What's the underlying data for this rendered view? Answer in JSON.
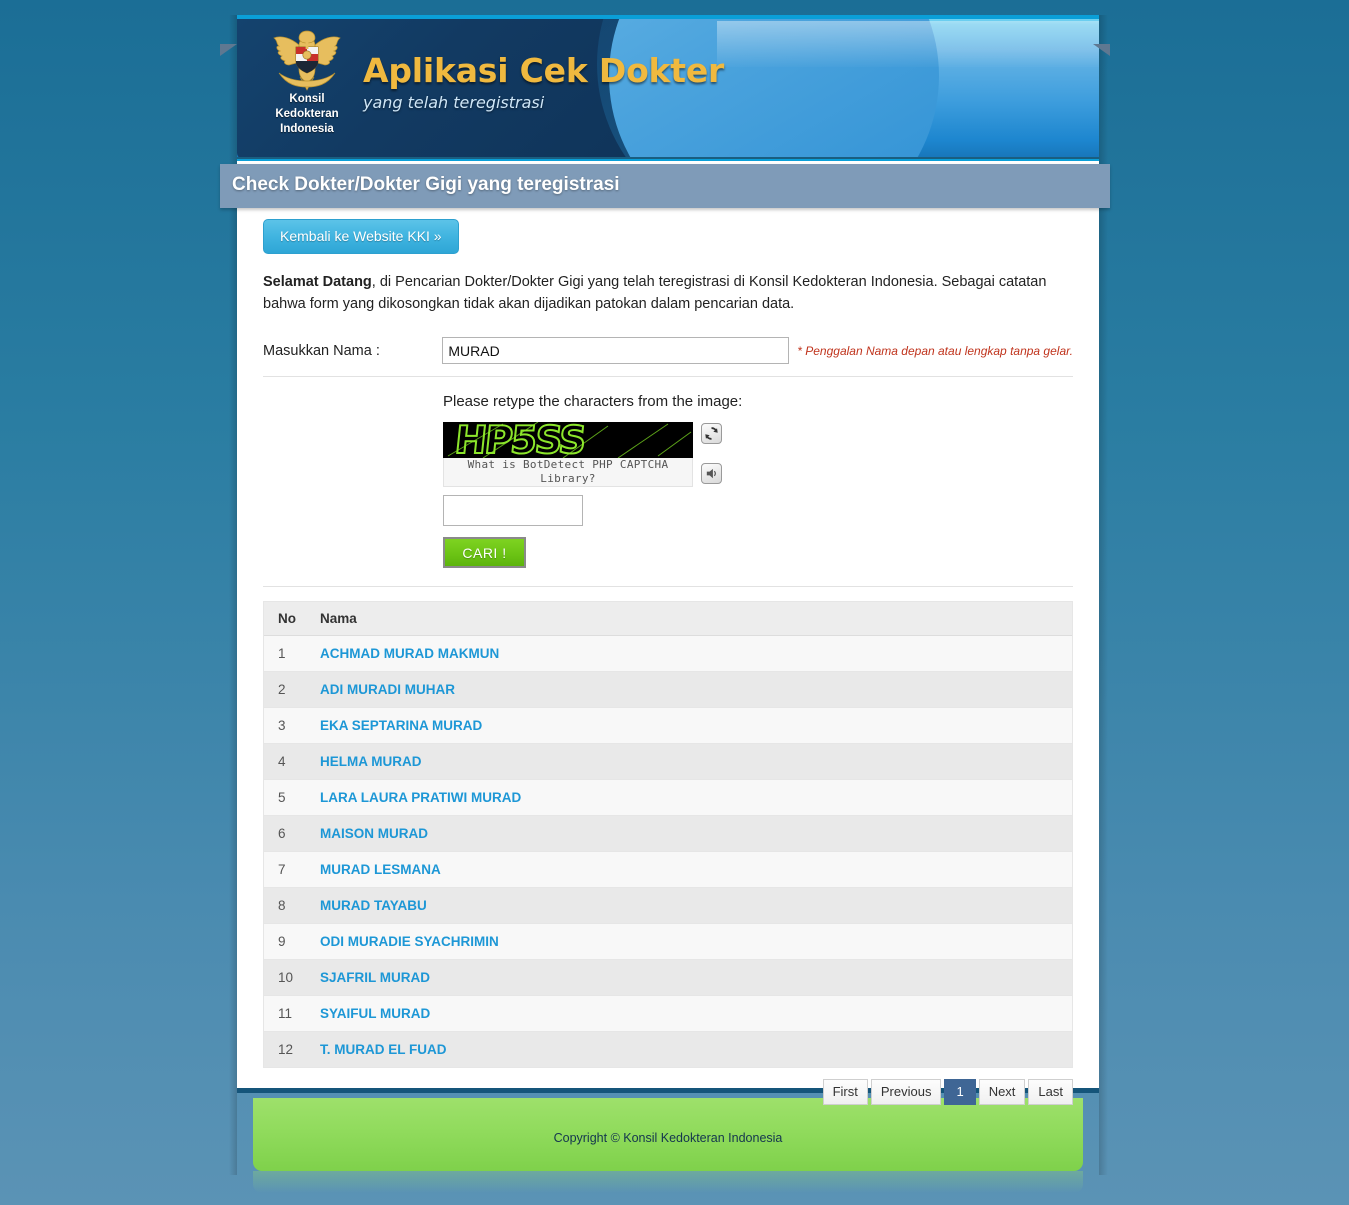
{
  "brand": {
    "emblem_caption_line1": "Konsil",
    "emblem_caption_line2": "Kedokteran",
    "emblem_caption_line3": "Indonesia",
    "title": "Aplikasi Cek Dokter",
    "subtitle": "yang telah teregistrasi",
    "title_color": "#f0b93f"
  },
  "ribbon": {
    "title": "Check Dokter/Dokter Gigi yang teregistrasi",
    "background": "#7f9bb8"
  },
  "actions": {
    "back_label": "Kembali ke Website KKI »"
  },
  "welcome": {
    "lead": "Selamat Datang",
    "rest": ", di Pencarian Dokter/Dokter Gigi yang telah teregistrasi di Konsil Kedokteran Indonesia. Sebagai catatan bahwa form yang dikosongkan tidak akan dijadikan patokan dalam pencarian data."
  },
  "form": {
    "name_label": "Masukkan Nama :",
    "name_value": "MURAD",
    "name_placeholder": "",
    "name_hint": "* Penggalan Nama depan atau lengkap tanpa gelar.",
    "hint_color": "#c0341d",
    "captcha_prompt": "Please retype the characters from the image:",
    "captcha_text": "HP5SS",
    "captcha_link": "What is BotDetect PHP CAPTCHA Library?",
    "captcha_input_value": "",
    "captcha_input_placeholder": "",
    "reload_icon": "refresh-icon",
    "sound_icon": "sound-icon",
    "submit_label": "CARI !",
    "submit_color": "#6cc415"
  },
  "results": {
    "columns": [
      "No",
      "Nama"
    ],
    "rows": [
      {
        "no": "1",
        "name": "ACHMAD MURAD MAKMUN"
      },
      {
        "no": "2",
        "name": "ADI MURADI MUHAR"
      },
      {
        "no": "3",
        "name": "EKA SEPTARINA MURAD"
      },
      {
        "no": "4",
        "name": "HELMA MURAD"
      },
      {
        "no": "5",
        "name": "LARA LAURA PRATIWI MURAD"
      },
      {
        "no": "6",
        "name": "MAISON MURAD"
      },
      {
        "no": "7",
        "name": "MURAD LESMANA"
      },
      {
        "no": "8",
        "name": "MURAD TAYABU"
      },
      {
        "no": "9",
        "name": "ODI MURADIE SYACHRIMIN"
      },
      {
        "no": "10",
        "name": "SJAFRIL MURAD"
      },
      {
        "no": "11",
        "name": "SYAIFUL MURAD"
      },
      {
        "no": "12",
        "name": "T. MURAD EL FUAD"
      }
    ],
    "link_color": "#1d97d6"
  },
  "pagination": {
    "first": "First",
    "previous": "Previous",
    "current": "1",
    "next": "Next",
    "last": "Last",
    "active_color": "#3f6695"
  },
  "footer": {
    "copyright": "Copyright © Konsil Kedokteran Indonesia",
    "background": "#92dc5e"
  }
}
